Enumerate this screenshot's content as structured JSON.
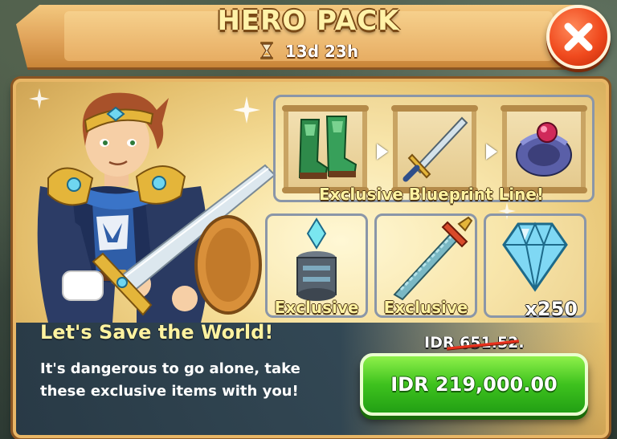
{
  "header": {
    "title": "HERO PACK",
    "timer": "13d 23h"
  },
  "blueprint": {
    "label": "Exclusive Blueprint Line!",
    "items": [
      "boots-icon",
      "sword-icon",
      "bracer-icon"
    ]
  },
  "items": [
    {
      "icon": "tower-icon",
      "label": "Exclusive"
    },
    {
      "icon": "pixel-sword-icon",
      "label": "Exclusive"
    },
    {
      "icon": "gem-icon",
      "quantity": "x250"
    }
  ],
  "offer": {
    "headline": "Let's Save the World!",
    "description": "It's dangerous to go alone, take these exclusive items with you!",
    "old_price": "IDR 651.52.",
    "price_label": "IDR 219,000.00"
  },
  "colors": {
    "title_text": "#fff2a8",
    "buy_button": "#3ec21e",
    "close_button": "#f04a1e"
  }
}
